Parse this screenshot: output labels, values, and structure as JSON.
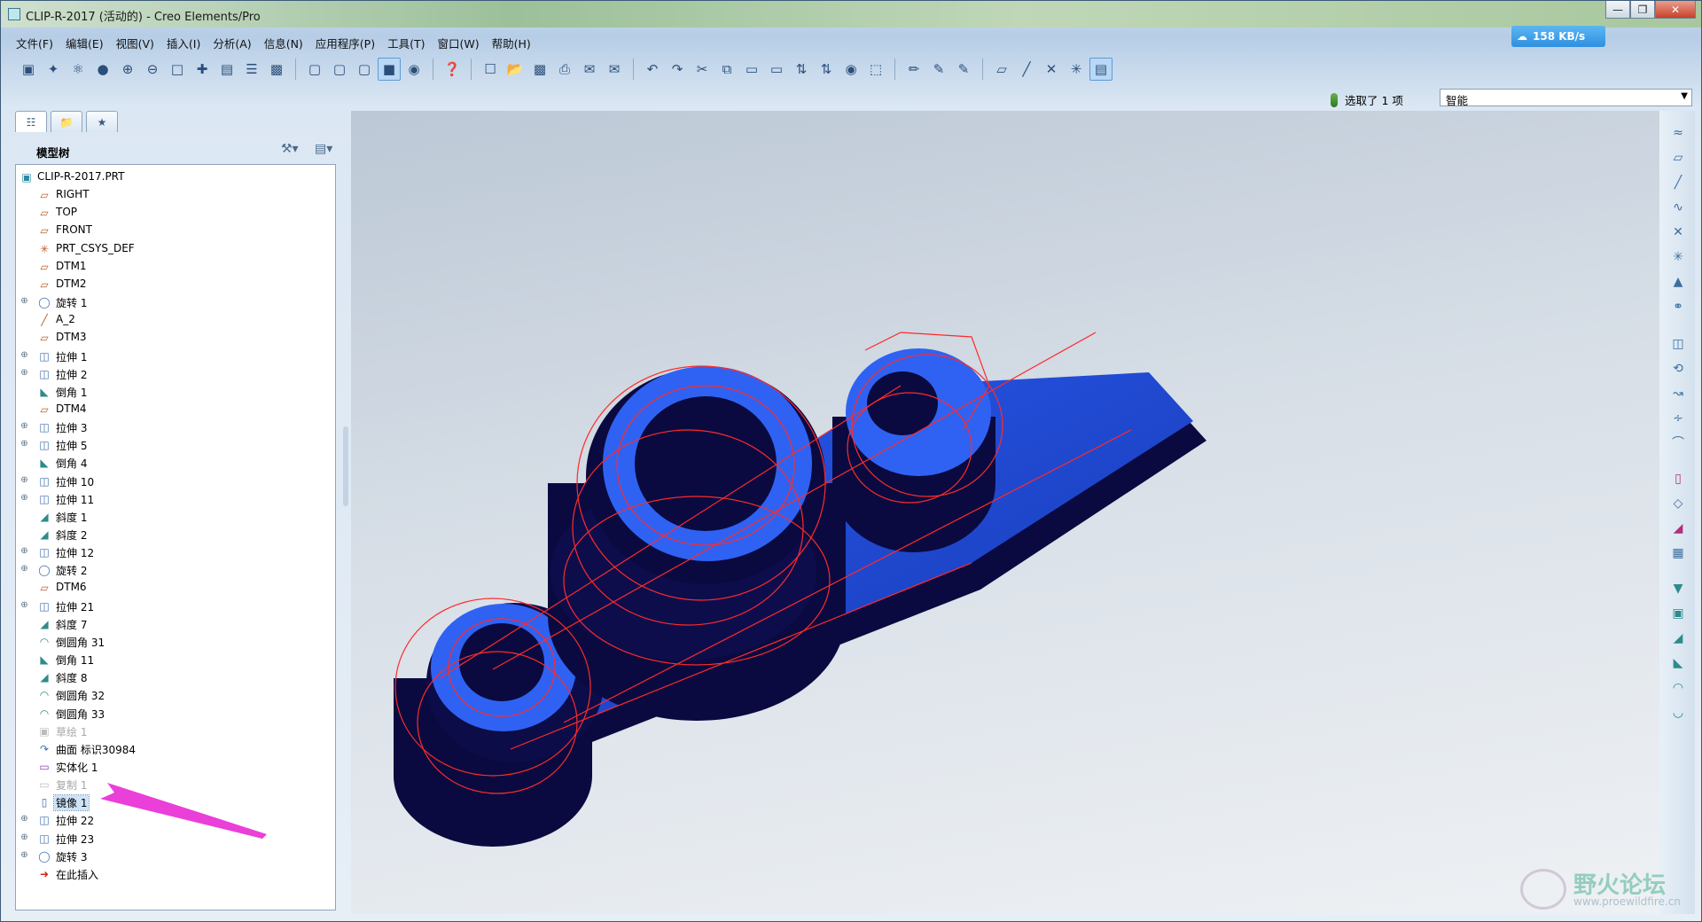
{
  "window": {
    "title": "CLIP-R-2017 (活动的) - Creo Elements/Pro"
  },
  "menu": [
    "文件(F)",
    "编辑(E)",
    "视图(V)",
    "插入(I)",
    "分析(A)",
    "信息(N)",
    "应用程序(P)",
    "工具(T)",
    "窗口(W)",
    "帮助(H)"
  ],
  "netbadge": {
    "speed": "158 KB/s"
  },
  "selection": {
    "status": "选取了 1 项",
    "filter": "智能"
  },
  "panel": {
    "tab1": "模型树",
    "header": "模型树"
  },
  "tree": [
    {
      "label": "CLIP-R-2017.PRT",
      "icon": "part-icon",
      "expand": false,
      "state": "normal"
    },
    {
      "label": "RIGHT",
      "icon": "datum-plane-icon",
      "expand": false,
      "state": "normal"
    },
    {
      "label": "TOP",
      "icon": "datum-plane-icon",
      "expand": false,
      "state": "normal"
    },
    {
      "label": "FRONT",
      "icon": "datum-plane-icon",
      "expand": false,
      "state": "normal"
    },
    {
      "label": "PRT_CSYS_DEF",
      "icon": "csys-icon",
      "expand": false,
      "state": "normal"
    },
    {
      "label": "DTM1",
      "icon": "datum-plane-icon",
      "expand": false,
      "state": "normal"
    },
    {
      "label": "DTM2",
      "icon": "datum-plane-icon",
      "expand": false,
      "state": "normal"
    },
    {
      "label": "旋转 1",
      "icon": "revolve-icon",
      "expand": true,
      "state": "normal"
    },
    {
      "label": "A_2",
      "icon": "axis-icon",
      "expand": false,
      "state": "normal"
    },
    {
      "label": "DTM3",
      "icon": "datum-plane-icon",
      "expand": false,
      "state": "normal"
    },
    {
      "label": "拉伸 1",
      "icon": "extrude-icon",
      "expand": true,
      "state": "normal"
    },
    {
      "label": "拉伸 2",
      "icon": "extrude-icon",
      "expand": true,
      "state": "normal"
    },
    {
      "label": "倒角 1",
      "icon": "chamfer-icon",
      "expand": false,
      "state": "normal"
    },
    {
      "label": "DTM4",
      "icon": "datum-plane-icon",
      "expand": false,
      "state": "normal"
    },
    {
      "label": "拉伸 3",
      "icon": "extrude-icon",
      "expand": true,
      "state": "normal"
    },
    {
      "label": "拉伸 5",
      "icon": "extrude-icon",
      "expand": true,
      "state": "normal"
    },
    {
      "label": "倒角 4",
      "icon": "chamfer-icon",
      "expand": false,
      "state": "normal"
    },
    {
      "label": "拉伸 10",
      "icon": "extrude-icon",
      "expand": true,
      "state": "normal"
    },
    {
      "label": "拉伸 11",
      "icon": "extrude-icon",
      "expand": true,
      "state": "normal"
    },
    {
      "label": "斜度 1",
      "icon": "draft-icon",
      "expand": false,
      "state": "normal"
    },
    {
      "label": "斜度 2",
      "icon": "draft-icon",
      "expand": false,
      "state": "normal"
    },
    {
      "label": "拉伸 12",
      "icon": "extrude-icon",
      "expand": true,
      "state": "normal"
    },
    {
      "label": "旋转 2",
      "icon": "revolve-icon",
      "expand": true,
      "state": "normal"
    },
    {
      "label": "DTM6",
      "icon": "datum-plane-icon",
      "expand": false,
      "state": "normal"
    },
    {
      "label": "拉伸 21",
      "icon": "extrude-icon",
      "expand": true,
      "state": "normal"
    },
    {
      "label": "斜度 7",
      "icon": "draft-icon",
      "expand": false,
      "state": "normal"
    },
    {
      "label": "倒圆角 31",
      "icon": "round-icon",
      "expand": false,
      "state": "normal"
    },
    {
      "label": "倒角 11",
      "icon": "chamfer-icon",
      "expand": false,
      "state": "normal"
    },
    {
      "label": "斜度 8",
      "icon": "draft-icon",
      "expand": false,
      "state": "normal"
    },
    {
      "label": "倒圆角 32",
      "icon": "round-icon",
      "expand": false,
      "state": "normal"
    },
    {
      "label": "倒圆角 33",
      "icon": "round-icon",
      "expand": false,
      "state": "normal"
    },
    {
      "label": "草绘 1",
      "icon": "sketch-icon",
      "expand": false,
      "state": "dim"
    },
    {
      "label": "曲面 标识30984",
      "icon": "surface-icon",
      "expand": false,
      "state": "normal"
    },
    {
      "label": "实体化 1",
      "icon": "solidify-icon",
      "expand": false,
      "state": "normal"
    },
    {
      "label": "复制 1",
      "icon": "copy-icon",
      "expand": false,
      "state": "dim"
    },
    {
      "label": "镜像 1",
      "icon": "mirror-icon",
      "expand": false,
      "state": "highlight"
    },
    {
      "label": "拉伸 22",
      "icon": "extrude-icon",
      "expand": true,
      "state": "normal"
    },
    {
      "label": "拉伸 23",
      "icon": "extrude-icon",
      "expand": true,
      "state": "normal"
    },
    {
      "label": "旋转 3",
      "icon": "revolve-icon",
      "expand": true,
      "state": "normal"
    },
    {
      "label": "在此插入",
      "icon": "insert-here-icon",
      "expand": false,
      "state": "normal"
    }
  ],
  "watermark": {
    "title": "野火论坛",
    "url": "www.proewildfire.cn"
  },
  "colors": {
    "model_fill": "#1f4fd8",
    "model_dark": "#0a0a3c",
    "edge": "#ff2a2a",
    "annotation_arrow": "#ea3fd8"
  }
}
